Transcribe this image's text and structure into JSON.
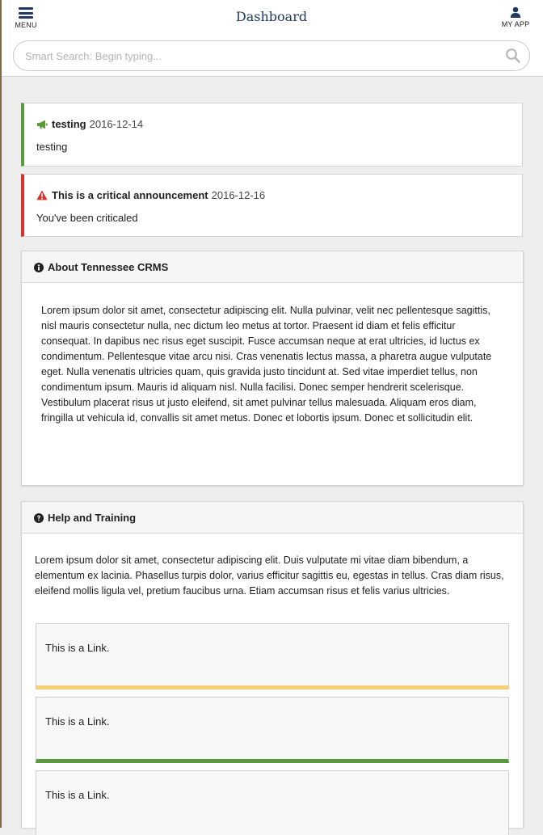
{
  "header": {
    "menu_label": "MENU",
    "title": "Dashboard",
    "app_label": "MY APP"
  },
  "search": {
    "placeholder": "Smart Search: Begin typing...",
    "value": ""
  },
  "announcements": [
    {
      "type": "info",
      "icon": "megaphone-icon",
      "title": "testing",
      "date": "2016-12-14",
      "message": "testing",
      "accent_color": "#5a9a3a"
    },
    {
      "type": "critical",
      "icon": "warning-icon",
      "title": "This is a critical announcement",
      "date": "2016-12-16",
      "message": "You've been criticaled",
      "accent_color": "#d9322b"
    }
  ],
  "about": {
    "icon": "info-circle-icon",
    "title": "About Tennessee CRMS",
    "body": "Lorem ipsum dolor sit amet, consectetur adipiscing elit. Nulla pulvinar, velit nec pellentesque sagittis, nisl mauris consectetur nulla, nec dictum leo metus at tortor. Praesent id diam et felis efficitur consequat. In dapibus nec risus eget suscipit. Fusce accumsan neque at erat ultricies, id luctus ex condimentum. Pellentesque vitae arcu nisi. Cras venenatis lectus massa, a pharetra augue vulputate eget. Nulla venenatis ultricies quam, quis gravida justo tincidunt at. Sed vitae imperdiet tellus, non condimentum ipsum. Mauris id aliquam nisl. Nulla facilisi. Donec semper hendrerit scelerisque. Vestibulum placerat risus ut justo eleifend, sit amet pulvinar tellus malesuada. Aliquam eros diam, fringilla ut vehicula id, convallis sit amet metus. Donec et lobortis ipsum. Donec et sollicitudin elit."
  },
  "help": {
    "icon": "question-circle-icon",
    "title": "Help and Training",
    "body": "Lorem ipsum dolor sit amet, consectetur adipiscing elit. Duis vulputate mi vitae diam bibendum, a elementum ex lacinia. Phasellus turpis dolor, varius efficitur sagittis eu, egestas in tellus. Cras diam risus, eleifend mollis ligula vel, pretium faucibus urna. Etiam accumsan risus et felis varius ultricies.",
    "links": [
      {
        "label": "This is a Link.",
        "accent_color": "#f5cf76"
      },
      {
        "label": "This is a Link.",
        "accent_color": "#5a9a3a"
      },
      {
        "label": "This is a Link.",
        "accent_color": ""
      }
    ]
  },
  "colors": {
    "header_text": "#1f3a60",
    "page_background": "#eeeeee",
    "info_accent": "#5a9a3a",
    "critical_accent": "#d9322b"
  }
}
